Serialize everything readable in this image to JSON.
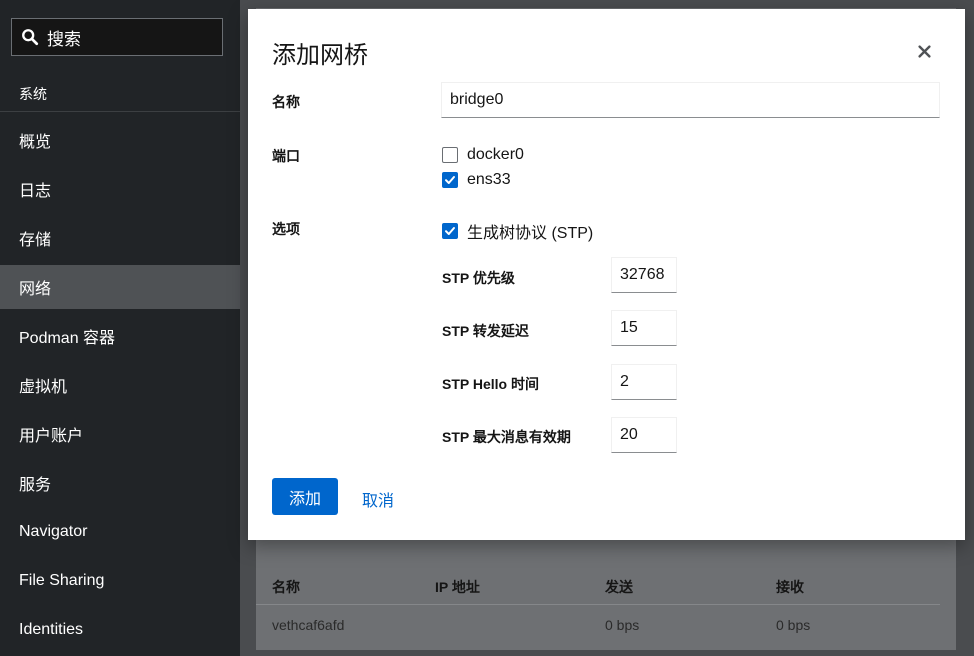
{
  "sidebar": {
    "search_label": "搜索",
    "section_label": "系统",
    "items": [
      {
        "label": "概览"
      },
      {
        "label": "日志"
      },
      {
        "label": "存储"
      },
      {
        "label": "网络"
      },
      {
        "label": "Podman 容器"
      },
      {
        "label": "虚拟机"
      },
      {
        "label": "用户账户"
      },
      {
        "label": "服务"
      },
      {
        "label": "Navigator"
      },
      {
        "label": "File Sharing"
      },
      {
        "label": "Identities"
      }
    ],
    "active_item": "网络"
  },
  "interfaces_table": {
    "headers": [
      "名称",
      "IP 地址",
      "发送",
      "接收"
    ],
    "rows": [
      [
        "vethcaf6afd",
        "",
        "0 bps",
        "0 bps"
      ]
    ]
  },
  "dialog": {
    "title": "添加网桥",
    "name_label": "名称",
    "name_value": "bridge0",
    "ports_label": "端口",
    "ports": [
      {
        "label": "docker0",
        "checked": false
      },
      {
        "label": "ens33",
        "checked": true
      }
    ],
    "options_label": "选项",
    "stp_checkbox": {
      "label": "生成树协议 (STP)",
      "checked": true
    },
    "stp_fields": [
      {
        "label": "STP 优先级",
        "value": "32768"
      },
      {
        "label": "STP 转发延迟",
        "value": "15"
      },
      {
        "label": "STP Hello 时间",
        "value": "2"
      },
      {
        "label": "STP 最大消息有效期",
        "value": "20"
      }
    ],
    "add_label": "添加",
    "cancel_label": "取消"
  },
  "colors": {
    "accent": "#0066cc",
    "sidebar_bg": "#212427",
    "active_nav_bg": "#4f5255"
  }
}
